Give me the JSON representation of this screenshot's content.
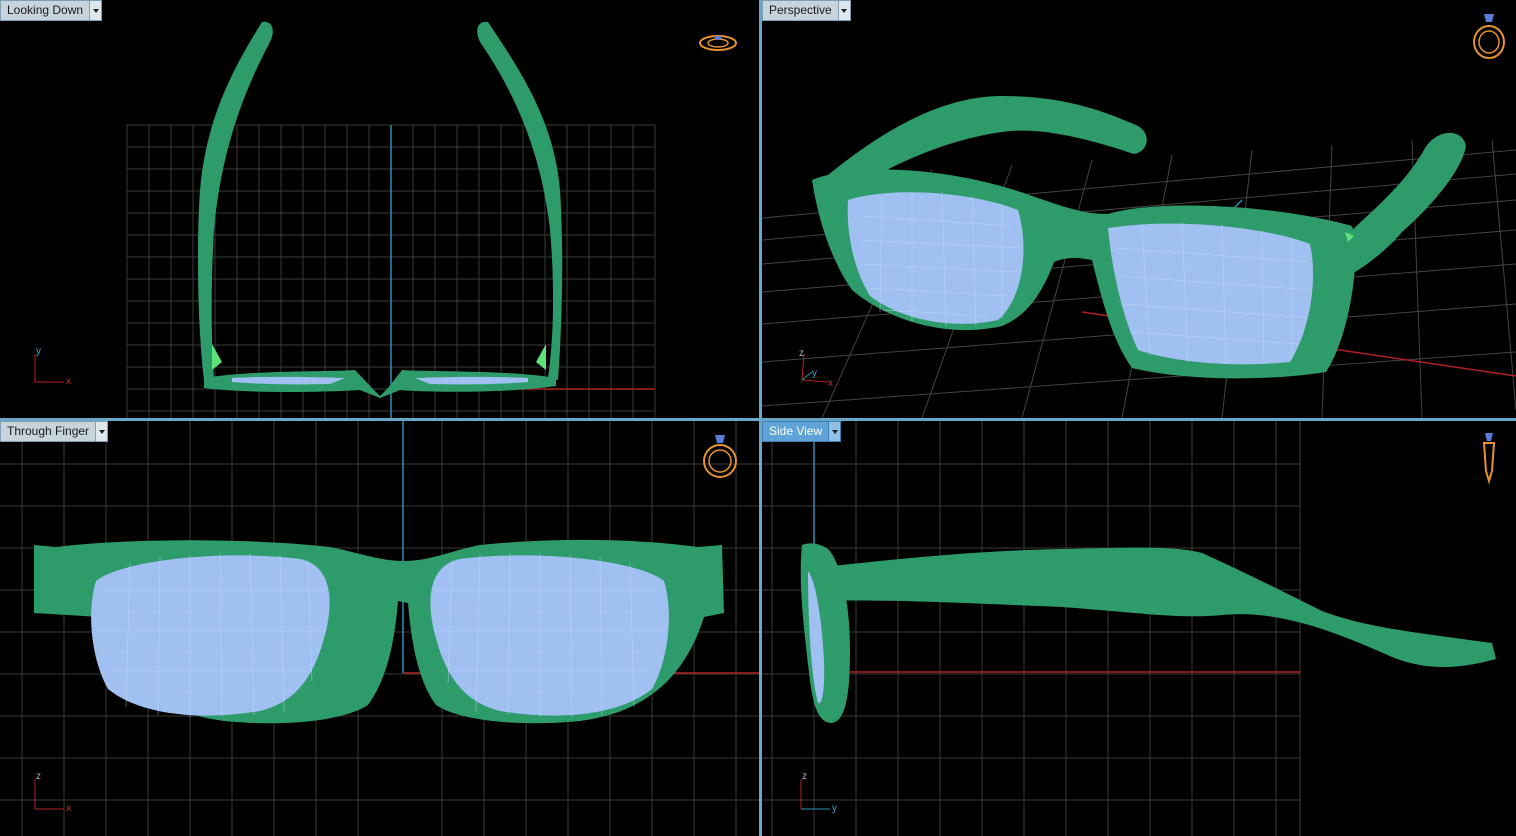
{
  "viewports": {
    "top_left": {
      "label": "Looking Down",
      "axis_a": "y",
      "axis_b": "x",
      "active": false
    },
    "top_right": {
      "label": "Perspective",
      "axis_a": "z",
      "axis_b": "y",
      "axis_c": "x",
      "active": false
    },
    "bottom_left": {
      "label": "Through Finger",
      "axis_a": "z",
      "axis_b": "x",
      "active": false
    },
    "bottom_right": {
      "label": "Side View",
      "axis_a": "z",
      "axis_b": "y",
      "active": true
    }
  },
  "icons": {
    "view_menu": "chevron-down-icon",
    "view_cube": "ring-icon",
    "axis_triad": "axis-triad-icon"
  },
  "colors": {
    "frame": "#2e9b6a",
    "lens": "#9fc0f0",
    "grid": "#3c3c3c",
    "axis_x": "#b22222",
    "axis_y": "#2a8fb0",
    "label_bg": "#c8d4dc",
    "label_active_bg": "#5fa3d8",
    "ring": "#e8932f"
  }
}
